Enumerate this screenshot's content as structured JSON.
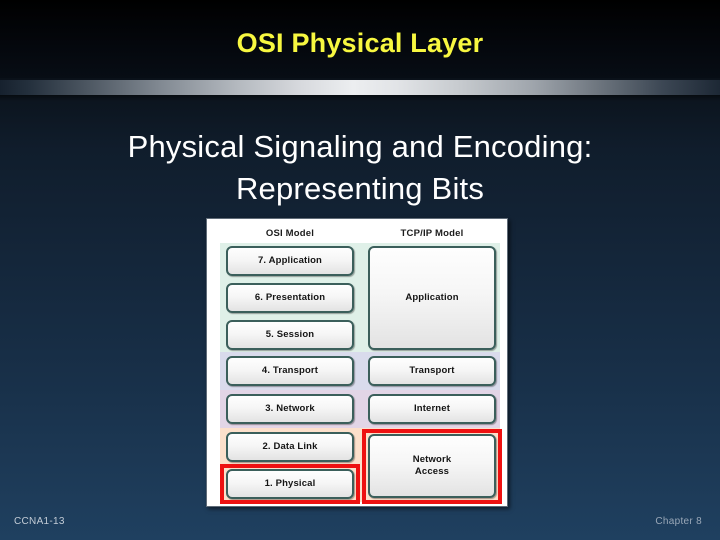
{
  "slide": {
    "title": "OSI Physical Layer",
    "title_color": "#f7f740",
    "headline_line1": "Physical Signaling and Encoding:",
    "headline_line2": "Representing Bits",
    "headline_color": "#ffffff",
    "background_top_color": "#000000",
    "background_bottom_color": "#1f4060",
    "divider_color": "#eceef0"
  },
  "diagram": {
    "osi_header": "OSI Model",
    "tcpip_header": "TCP/IP Model",
    "highlight_color": "#ee1111",
    "box_border_color": "#3b5f5b",
    "osi_layers": [
      {
        "label": "7. Application",
        "band_color": "#dff0e8",
        "highlighted": false
      },
      {
        "label": "6. Presentation",
        "band_color": "#dff0e8",
        "highlighted": false
      },
      {
        "label": "5. Session",
        "band_color": "#dff0e8",
        "highlighted": false
      },
      {
        "label": "4. Transport",
        "band_color": "#d9dbec",
        "highlighted": false
      },
      {
        "label": "3. Network",
        "band_color": "#e2d5e6",
        "highlighted": false
      },
      {
        "label": "2. Data Link",
        "band_color": "#fce0cb",
        "highlighted": false
      },
      {
        "label": "1. Physical",
        "band_color": "#fce0cb",
        "highlighted": true
      }
    ],
    "tcpip_layers": [
      {
        "label": "Application",
        "spans": 3,
        "highlighted": false
      },
      {
        "label": "Transport",
        "spans": 1,
        "highlighted": false
      },
      {
        "label": "Internet",
        "spans": 1,
        "highlighted": false
      },
      {
        "label_line1": "Network",
        "label_line2": "Access",
        "spans": 2,
        "highlighted": true
      }
    ]
  },
  "footer": {
    "left": "CCNA1-13",
    "right": "Chapter 8"
  }
}
